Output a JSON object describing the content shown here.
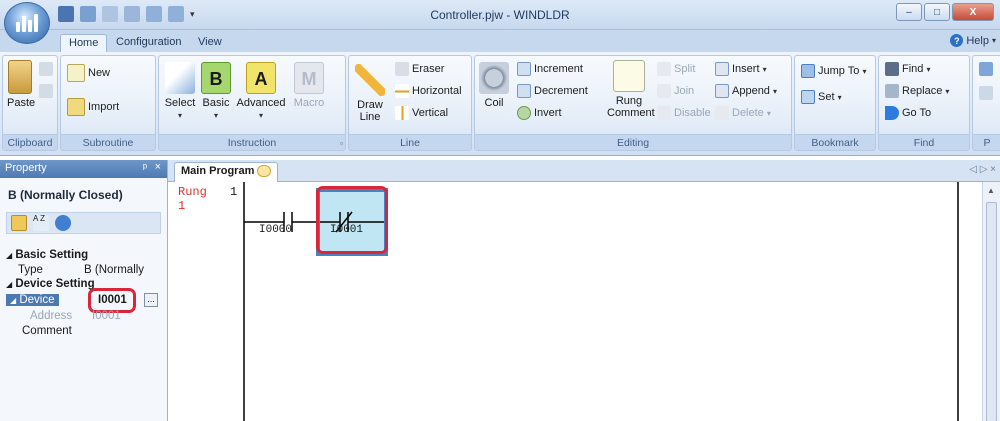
{
  "window": {
    "title": "Controller.pjw - WINDLDR",
    "minimize": "–",
    "maximize": "□",
    "close": "X"
  },
  "ribbon_tabs": [
    "Home",
    "Configuration",
    "View"
  ],
  "help_label": "Help",
  "groups": {
    "clipboard": {
      "label": "Clipboard",
      "paste": "Paste"
    },
    "subroutine": {
      "label": "Subroutine",
      "new": "New",
      "import": "Import"
    },
    "instruction": {
      "label": "Instruction",
      "select": "Select",
      "basic": "Basic",
      "advanced": "Advanced",
      "macro": "Macro"
    },
    "line": {
      "label": "Line",
      "draw_line": "Draw Line",
      "eraser": "Eraser",
      "horizontal": "Horizontal",
      "vertical": "Vertical"
    },
    "editing": {
      "label": "Editing",
      "coil": "Coil",
      "increment": "Increment",
      "decrement": "Decrement",
      "invert": "Invert",
      "rung_comment": "Rung Comment",
      "split": "Split",
      "join": "Join",
      "disable": "Disable",
      "insert": "Insert",
      "append": "Append",
      "delete": "Delete"
    },
    "bookmark": {
      "label": "Bookmark",
      "jump_to": "Jump To",
      "set": "Set"
    },
    "find": {
      "label": "Find",
      "find": "Find",
      "replace": "Replace",
      "go_to": "Go To"
    },
    "partial": {
      "label": "P"
    }
  },
  "property_panel": {
    "title": "Property",
    "pin": "ᵖ",
    "close": "×",
    "instruction_type": "B (Normally Closed)",
    "sections": {
      "basic_setting": "Basic Setting",
      "type_label": "Type",
      "type_value": "B (Normally",
      "device_setting": "Device Setting",
      "device_label": "Device",
      "device_value": "I0001",
      "ellipsis": "...",
      "address_label": "Address",
      "address_value": "I0001",
      "comment_label": "Comment"
    }
  },
  "document": {
    "tab_label": "Main Program",
    "nav": "◁ ▷ ×",
    "rung_label": "Rung",
    "rung_number_top": "1",
    "rung_number_side": "1",
    "contacts": [
      {
        "device": "I0000",
        "kind": "normally_open"
      },
      {
        "device": "I0001",
        "kind": "normally_closed"
      }
    ]
  },
  "colors": {
    "highlight": "#d8273a",
    "rung_text": "#d8352a",
    "selection_fill": "#bfe6f2",
    "selection_border": "#4c7fbf"
  }
}
